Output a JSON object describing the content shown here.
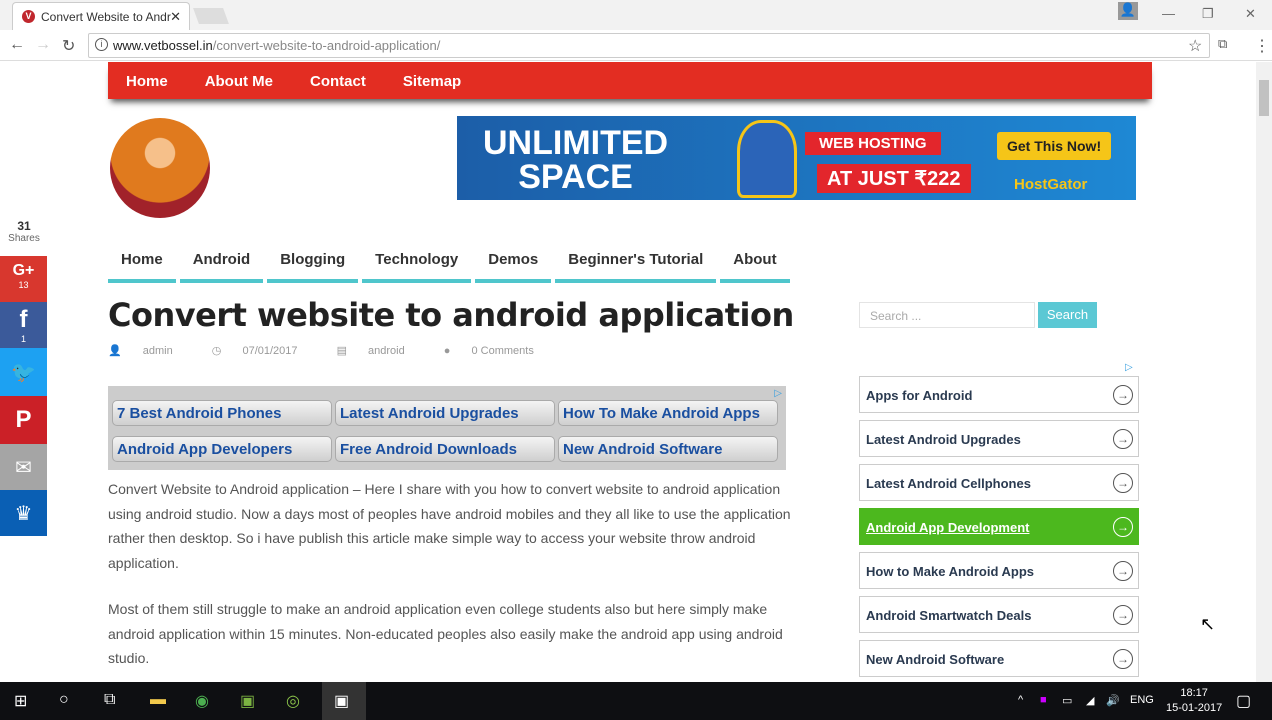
{
  "browser": {
    "tab_title": "Convert Website to Andr",
    "url_domain": "www.vetbossel.in",
    "url_path": "/convert-website-to-android-application/"
  },
  "topnav": [
    "Home",
    "About Me",
    "Contact",
    "Sitemap"
  ],
  "banner": {
    "line1": "UNLIMITED",
    "line2": "SPACE",
    "hosting": "WEB HOSTING",
    "price": "AT JUST ₹222",
    "cta": "Get This Now!",
    "brand": "HostGator"
  },
  "share": {
    "count": "31",
    "label": "Shares",
    "gplus": "13",
    "facebook": "1"
  },
  "menu": [
    "Home",
    "Android",
    "Blogging",
    "Technology",
    "Demos",
    "Beginner's Tutorial",
    "About"
  ],
  "post": {
    "title": "Convert website to android application",
    "author": "admin",
    "date": "07/01/2017",
    "category": "android",
    "comments": "0 Comments",
    "p1": "Convert Website to Android application – Here I share with you how to convert website to android application using android studio. Now a days most of peoples have android mobiles and they all like to use the application rather then desktop. So i have publish this article make simple way to access your website throw android application.",
    "p2": "Most of them still struggle to make an android application even college students also but here simply make android application within 15 minutes. Non-educated peoples also easily make the android app using android studio."
  },
  "ad_links": [
    "7 Best Android Phones",
    "Latest Android Upgrades",
    "How To Make Android Apps",
    "Android App Developers",
    "Free Android Downloads",
    "New Android Software"
  ],
  "sidebar": {
    "search_placeholder": "Search ...",
    "search_button": "Search",
    "links": [
      "Apps for Android",
      "Latest Android Upgrades",
      "Latest Android Cellphones",
      "Android App Development",
      "How to Make Android Apps",
      "Android Smartwatch Deals",
      "New Android Software"
    ]
  },
  "taskbar": {
    "lang": "ENG",
    "time": "18:17",
    "date": "15-01-2017"
  },
  "colors": {
    "accent_red": "#e32d22",
    "teal": "#4fc6cc",
    "active_green": "#4cb81e"
  }
}
